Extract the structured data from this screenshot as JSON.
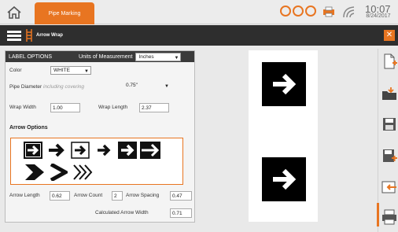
{
  "header": {
    "tab_label": "Pipe Marking",
    "time": "10:07",
    "date": "8/24/2017"
  },
  "toolbar": {
    "title": "Arrow Wrap"
  },
  "panel": {
    "section_label": "LABEL OPTIONS",
    "uom_label": "Units of Measurement",
    "uom_value": "Inches",
    "color_label": "Color",
    "color_value": "WHITE",
    "pipe_diameter_label": "Pipe Diameter",
    "pipe_diameter_hint": "including covering",
    "pipe_diameter_value": "0.75\"",
    "wrap_width_label": "Wrap Width",
    "wrap_width_value": "1.00",
    "wrap_length_label": "Wrap Length",
    "wrap_length_value": "2.37",
    "arrow_options_title": "Arrow Options",
    "arrow_length_label": "Arrow Length",
    "arrow_length_value": "0.62",
    "arrow_count_label": "Arrow Count",
    "arrow_count_value": "2",
    "arrow_spacing_label": "Arrow Spacing",
    "arrow_spacing_value": "0.47",
    "calc_width_label": "Calculated Arrow Width",
    "calc_width_value": "0.71"
  },
  "colors": {
    "accent": "#e87521",
    "dark": "#2e2e2e"
  }
}
